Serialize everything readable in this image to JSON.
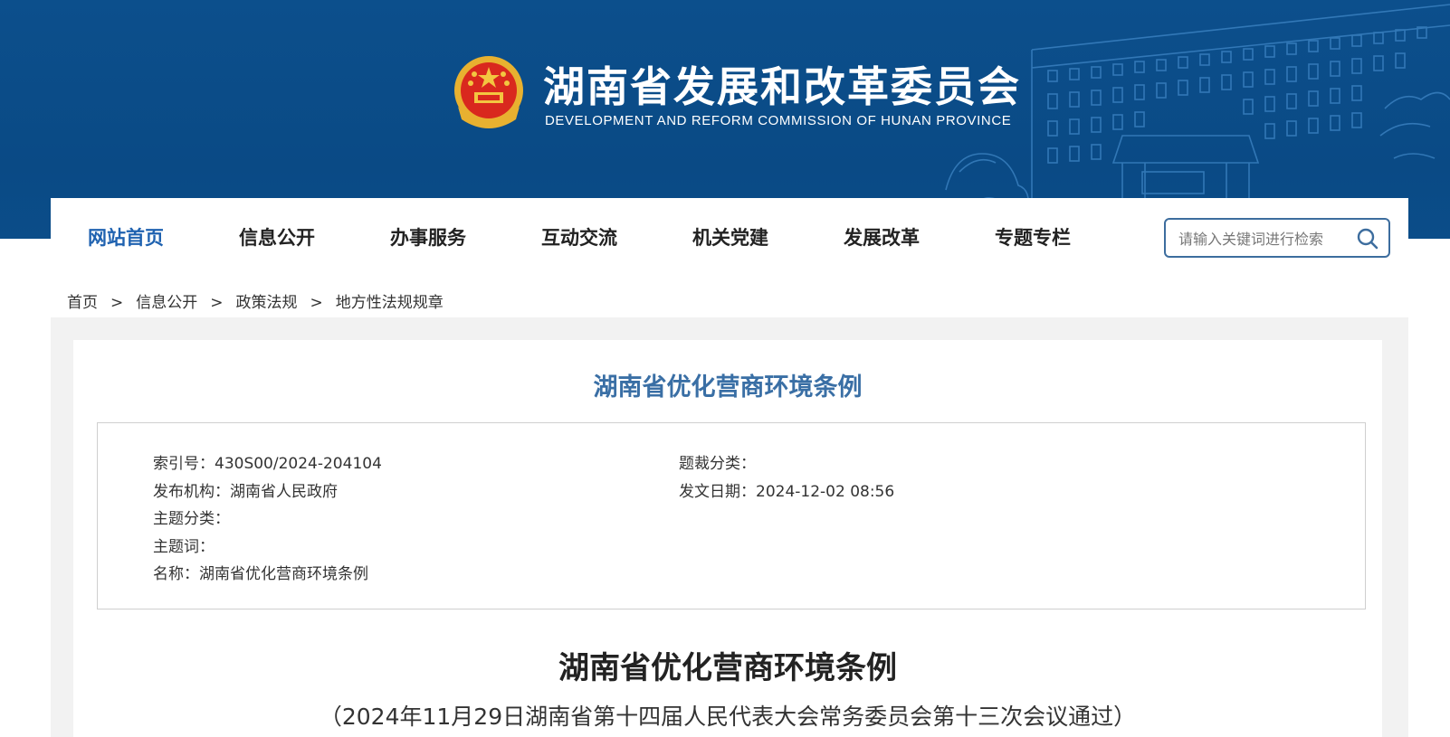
{
  "header": {
    "title": "湖南省发展和改革委员会",
    "subtitle": "DEVELOPMENT AND REFORM COMMISSION OF HUNAN PROVINCE",
    "colors": {
      "banner": "#0b4d89",
      "accent": "#1f62b0"
    }
  },
  "nav": {
    "items": [
      {
        "label": "网站首页",
        "active": true
      },
      {
        "label": "信息公开"
      },
      {
        "label": "办事服务"
      },
      {
        "label": "互动交流"
      },
      {
        "label": "机关党建"
      },
      {
        "label": "发展改革"
      },
      {
        "label": "专题专栏"
      }
    ],
    "search_placeholder": "请输入关键词进行检索",
    "search_icon": "search-icon"
  },
  "breadcrumb": {
    "items": [
      "首页",
      "信息公开",
      "政策法规",
      "地方性法规规章"
    ],
    "separator": ">"
  },
  "document": {
    "title": "湖南省优化营商环境条例",
    "meta": {
      "index_no": "索引号：430S00/2024-204104",
      "genre": "题裁分类：",
      "publisher": "发布机构：湖南省人民政府",
      "issue_date": "发文日期：2024-12-02 08:56",
      "topic_category": "主题分类：",
      "keywords": "主题词：",
      "name": "名称：湖南省优化营商环境条例"
    },
    "article_title": "湖南省优化营商环境条例",
    "article_subtitle": "（2024年11月29日湖南省第十四届人民代表大会常务委员会第十三次会议通过）"
  }
}
